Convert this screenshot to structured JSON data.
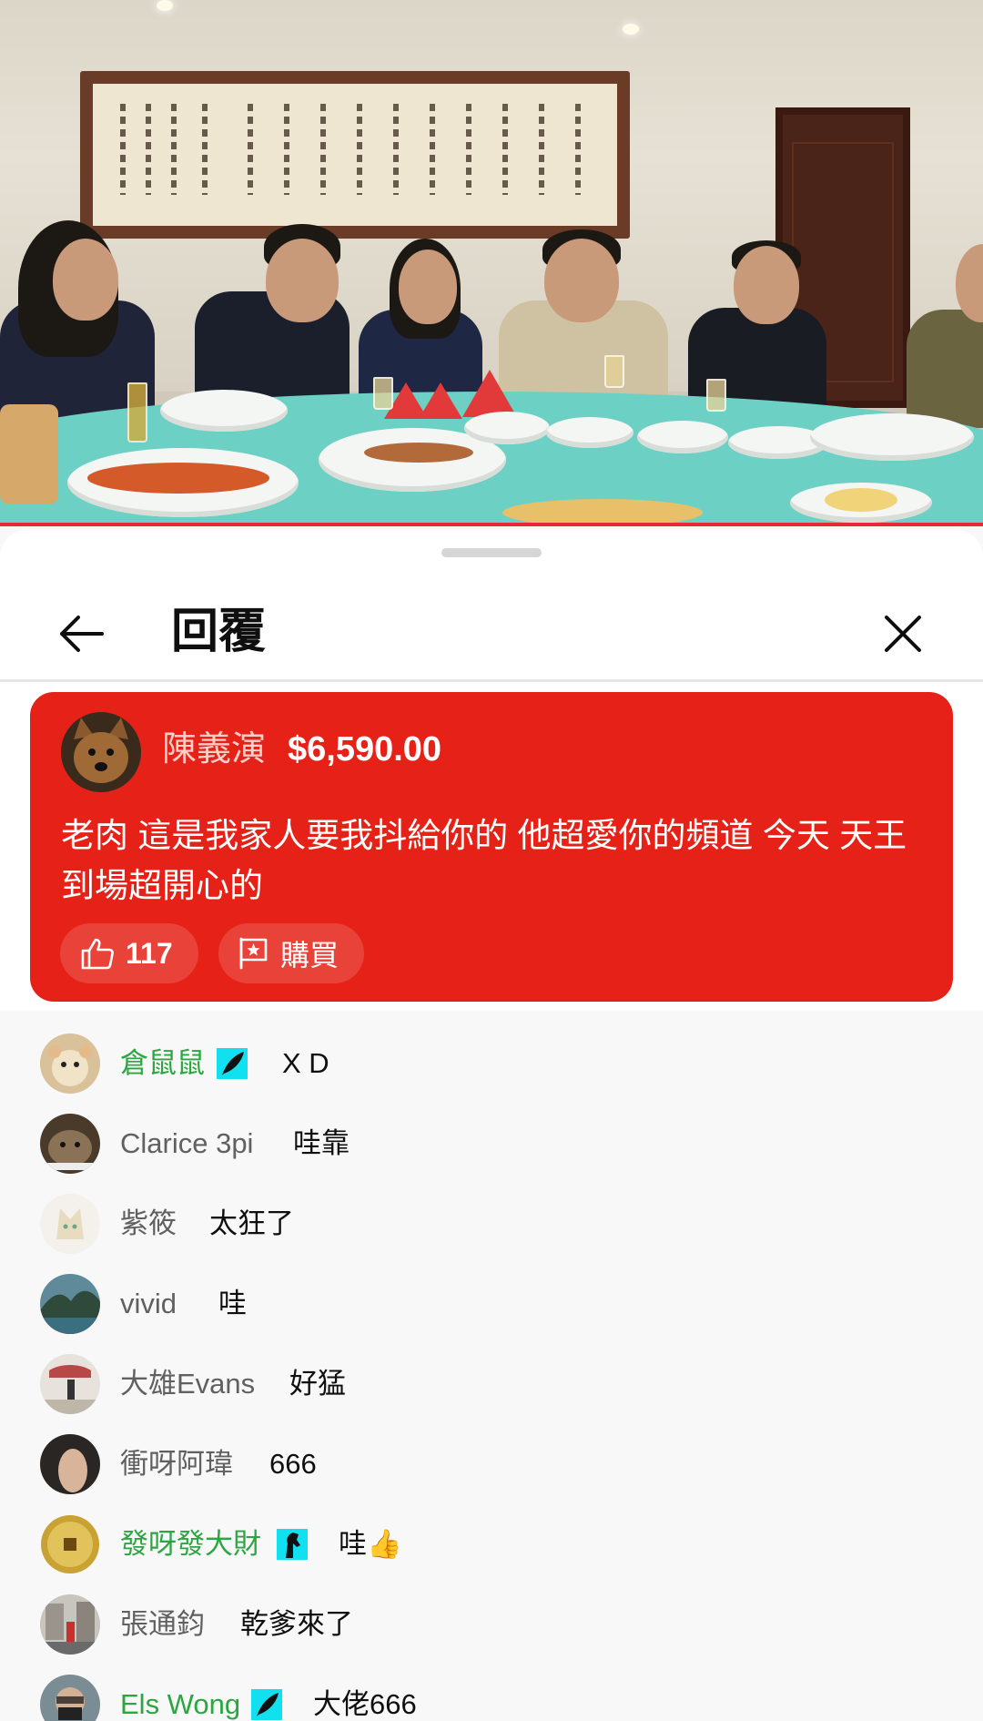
{
  "header": {
    "title": "回覆"
  },
  "superchat": {
    "author": "陳義演",
    "amount": "$6,590.00",
    "message": "老肉 這是我家人要我抖給你的 他超愛你的頻道 今天 天王到場超開心的",
    "likes": "117",
    "buy_label": "購買",
    "background_color": "#e62117"
  },
  "chat": [
    {
      "author": "倉鼠鼠",
      "message": "X D",
      "member": true,
      "badge": "feather-icon"
    },
    {
      "author": "Clarice 3pi",
      "message": "哇靠",
      "member": false
    },
    {
      "author": "紫筱",
      "message": "太狂了",
      "member": false
    },
    {
      "author": "vivid",
      "message": "哇",
      "member": false
    },
    {
      "author": "大雄Evans",
      "message": "好猛",
      "member": false
    },
    {
      "author": "衝呀阿瑋",
      "message": "666",
      "member": false
    },
    {
      "author": "發呀發大財",
      "message": "哇👍",
      "member": true,
      "badge": "horse-icon"
    },
    {
      "author": "張通鈞",
      "message": "乾爹來了",
      "member": false
    },
    {
      "author": "Els Wong",
      "message": "大佬666",
      "member": true,
      "badge": "feather-icon"
    }
  ],
  "colors": {
    "accent_red": "#e62117",
    "member_green": "#2ba640",
    "badge_cyan": "#10e0f0"
  }
}
